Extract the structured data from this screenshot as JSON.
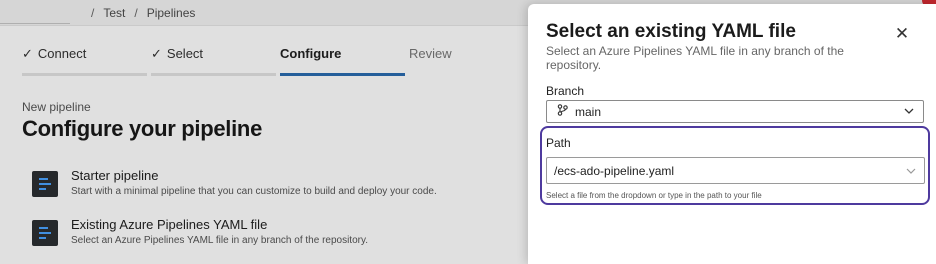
{
  "breadcrumb": {
    "items": [
      "Test",
      "Pipelines"
    ],
    "separator": "/"
  },
  "wizard": {
    "steps": [
      {
        "label": "Connect",
        "check": "✓",
        "state": "done"
      },
      {
        "label": "Select",
        "check": "✓",
        "state": "done"
      },
      {
        "label": "Configure",
        "check": "",
        "state": "active"
      },
      {
        "label": "Review",
        "check": "",
        "state": "pending"
      }
    ]
  },
  "page": {
    "subtitle": "New pipeline",
    "title": "Configure your pipeline",
    "options": [
      {
        "title": "Starter pipeline",
        "description": "Start with a minimal pipeline that you can customize to build and deploy your code.",
        "icon": "pipeline-file-icon"
      },
      {
        "title": "Existing Azure Pipelines YAML file",
        "description": "Select an Azure Pipelines YAML file in any branch of the repository.",
        "icon": "pipeline-file-icon"
      }
    ]
  },
  "dialog": {
    "title": "Select an existing YAML file",
    "description": "Select an Azure Pipelines YAML file in any branch of the repository.",
    "close_icon": "close-icon",
    "branch_label": "Branch",
    "branch_value": "main",
    "branch_icon": "git-branch-icon",
    "path_label": "Path",
    "path_value": "/ecs-ado-pipeline.yaml",
    "path_hint": "Select a file from the dropdown or type in the path to your file"
  },
  "colors": {
    "accent": "#2b6cb0",
    "highlight_border": "#4e3a9e",
    "corner_badge": "#c0262d"
  }
}
